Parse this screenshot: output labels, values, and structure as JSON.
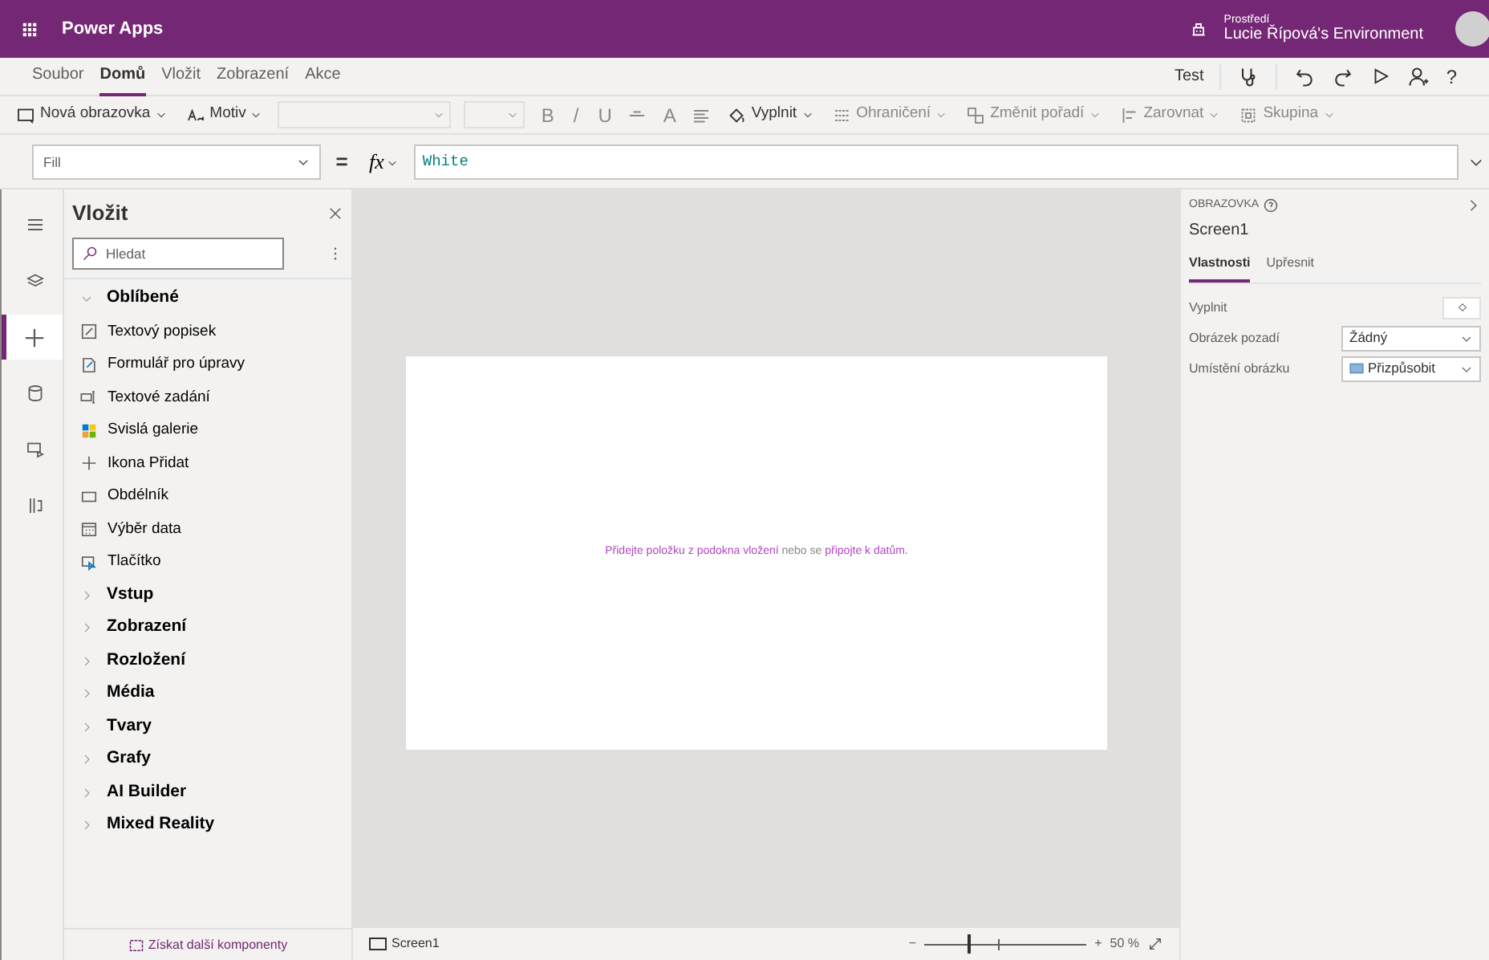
{
  "header": {
    "app_title": "Power Apps",
    "environment_label": "Prostředí",
    "environment_name": "Lucie Řípová's Environment"
  },
  "menu_tabs": [
    {
      "label": "Soubor",
      "selected": false
    },
    {
      "label": "Domů",
      "selected": true
    },
    {
      "label": "Vložit",
      "selected": false
    },
    {
      "label": "Zobrazení",
      "selected": false
    },
    {
      "label": "Akce",
      "selected": false
    }
  ],
  "test_label": "Test",
  "help_label": "?",
  "toolbar": [
    {
      "kind": "dropdown",
      "label": "Nová obrazovka",
      "disabled": false
    },
    {
      "kind": "dropdown",
      "label": "Motiv",
      "disabled": false
    },
    {
      "kind": "select",
      "disabled": true
    },
    {
      "kind": "select",
      "disabled": true
    },
    {
      "kind": "glyph",
      "label": "B",
      "disabled": true
    },
    {
      "kind": "glyph",
      "label": "/",
      "disabled": true
    },
    {
      "kind": "glyph",
      "label": "U",
      "disabled": true
    },
    {
      "kind": "icon",
      "disabled": true
    },
    {
      "kind": "glyph",
      "label": "A",
      "disabled": true
    },
    {
      "kind": "icon",
      "disabled": true
    },
    {
      "kind": "dropdown",
      "label": "Vyplnit",
      "disabled": false
    },
    {
      "kind": "dropdown",
      "label": "Ohraničení",
      "disabled": true
    },
    {
      "kind": "dropdown",
      "label": "Změnit pořadí",
      "disabled": true
    },
    {
      "kind": "dropdown",
      "label": "Zarovnat",
      "disabled": true
    },
    {
      "kind": "dropdown",
      "label": "Skupina",
      "disabled": true
    }
  ],
  "formula": {
    "property": "Fill",
    "equals": "=",
    "fx": "fx",
    "value": "White"
  },
  "rail": [
    {
      "selected": false
    },
    {
      "selected": false
    },
    {
      "selected": true
    },
    {
      "selected": false
    },
    {
      "selected": false
    },
    {
      "selected": false
    }
  ],
  "insert_panel": {
    "title": "Vložit",
    "search_placeholder": "Hledat",
    "groups": [
      {
        "label": "Oblíbené",
        "expanded": true,
        "children": [
          {
            "label": "Textový popisek"
          },
          {
            "label": "Formulář pro úpravy"
          },
          {
            "label": "Textové zadání"
          },
          {
            "label": "Svislá galerie"
          },
          {
            "label": "Ikona Přidat"
          },
          {
            "label": "Obdélník"
          },
          {
            "label": "Výběr data"
          },
          {
            "label": "Tlačítko"
          }
        ]
      },
      {
        "label": "Vstup",
        "expanded": false
      },
      {
        "label": "Zobrazení",
        "expanded": false
      },
      {
        "label": "Rozložení",
        "expanded": false
      },
      {
        "label": "Média",
        "expanded": false
      },
      {
        "label": "Tvary",
        "expanded": false
      },
      {
        "label": "Grafy",
        "expanded": false
      },
      {
        "label": "AI Builder",
        "expanded": false
      },
      {
        "label": "Mixed Reality",
        "expanded": false
      }
    ],
    "footer_link": "Získat další komponenty"
  },
  "canvas": {
    "link_1": "Přidejte položku z podokna vložení",
    "text": " nebo se ",
    "link_2": "připojte k datům."
  },
  "status_bar": {
    "screen_tab": "Screen1",
    "minus": "−",
    "plus": "+",
    "zoom": {
      "level": 0.27
    },
    "zoom_reading": "50 %"
  },
  "properties_panel": {
    "section_label": "OBRAZOVKA",
    "screen_name": "Screen1",
    "tabs": [
      {
        "label": "Vlastnosti",
        "selected": true
      },
      {
        "label": "Upřesnit",
        "selected": false
      }
    ],
    "rows": [
      {
        "kind": "color",
        "label": "Vyplnit"
      },
      {
        "kind": "dropdown",
        "label": "Obrázek pozadí",
        "value": "Žádný"
      },
      {
        "kind": "image-dropdown",
        "label": "Umístění obrázku",
        "value": "Přizpůsobit"
      }
    ]
  }
}
